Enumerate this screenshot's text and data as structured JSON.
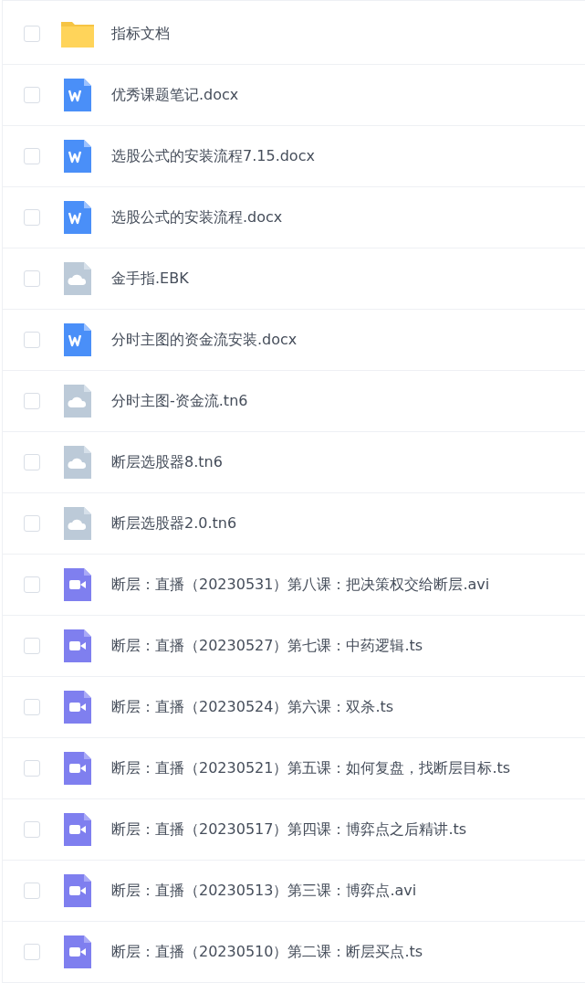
{
  "files": [
    {
      "kind": "folder",
      "name": "指标文档",
      "checked": false
    },
    {
      "kind": "word",
      "name": "优秀课题笔记.docx",
      "checked": false
    },
    {
      "kind": "word",
      "name": "选股公式的安装流程7.15.docx",
      "checked": false
    },
    {
      "kind": "word",
      "name": "选股公式的安装流程.docx",
      "checked": false
    },
    {
      "kind": "cloud",
      "name": "金手指.EBK",
      "checked": false
    },
    {
      "kind": "word",
      "name": "分时主图的资金流安装.docx",
      "checked": false
    },
    {
      "kind": "cloud",
      "name": "分时主图-资金流.tn6",
      "checked": false
    },
    {
      "kind": "cloud",
      "name": "断层选股器8.tn6",
      "checked": false
    },
    {
      "kind": "cloud",
      "name": "断层选股器2.0.tn6",
      "checked": false
    },
    {
      "kind": "video",
      "name": "断层：直播（20230531）第八课：把决策权交给断层.avi",
      "checked": false
    },
    {
      "kind": "video",
      "name": "断层：直播（20230527）第七课：中药逻辑.ts",
      "checked": false
    },
    {
      "kind": "video",
      "name": "断层：直播（20230524）第六课：双杀.ts",
      "checked": false
    },
    {
      "kind": "video",
      "name": "断层：直播（20230521）第五课：如何复盘，找断层目标.ts",
      "checked": false
    },
    {
      "kind": "video",
      "name": "断层：直播（20230517）第四课：博弈点之后精讲.ts",
      "checked": false
    },
    {
      "kind": "video",
      "name": "断层：直播（20230513）第三课：博弈点.avi",
      "checked": false
    },
    {
      "kind": "video",
      "name": "断层：直播（20230510）第二课：断层买点.ts",
      "checked": false
    }
  ]
}
